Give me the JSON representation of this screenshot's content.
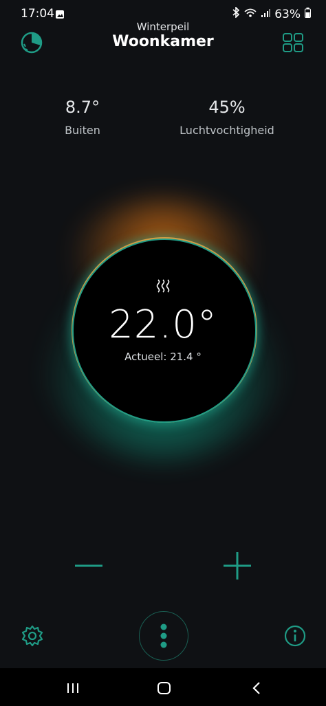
{
  "status_bar": {
    "time": "17:04",
    "battery": "63%",
    "icons": [
      "image-icon",
      "bluetooth-icon",
      "wifi-icon",
      "signal-icon",
      "battery-icon"
    ]
  },
  "header": {
    "subtitle": "Winterpeil",
    "title": "Woonkamer",
    "left_icon": "schedule-icon",
    "right_icon": "grid-icon"
  },
  "stats": {
    "outside": {
      "value": "8.7°",
      "label": "Buiten"
    },
    "humidity": {
      "value": "45%",
      "label": "Luchtvochtigheid"
    }
  },
  "thermostat": {
    "mode_icon": "heating-icon",
    "setpoint": "22.0°",
    "actual": "Actueel: 21.4 °"
  },
  "controls": {
    "decrease_icon": "minus-icon",
    "increase_icon": "plus-icon",
    "settings_icon": "gear-icon",
    "more_icon": "more-vertical-icon",
    "info_icon": "info-icon"
  },
  "navbar": {
    "icons": [
      "recent-apps-icon",
      "home-icon",
      "back-icon"
    ]
  },
  "colors": {
    "accent": "#1f9c86",
    "warm": "#e67814",
    "background": "#0f1114"
  }
}
